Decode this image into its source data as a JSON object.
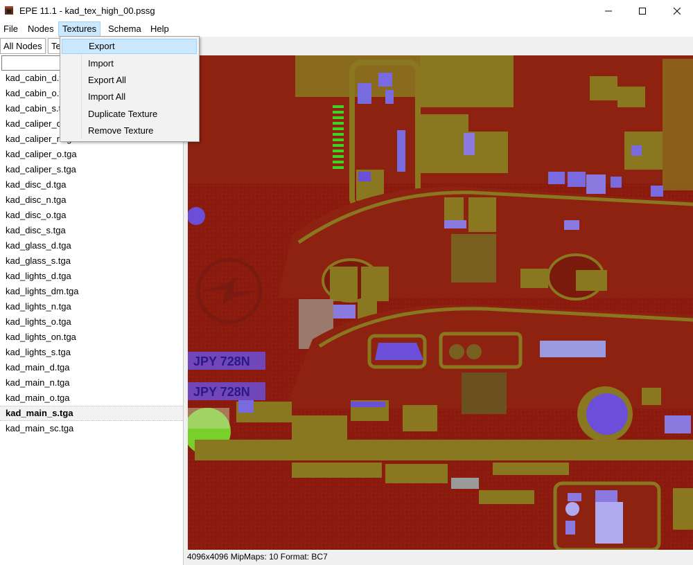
{
  "window": {
    "title": "EPE 11.1 - kad_tex_high_00.pssg",
    "minimize_icon": "minimize-icon",
    "maximize_icon": "maximize-icon",
    "close_icon": "close-icon"
  },
  "menu": {
    "file": "File",
    "nodes": "Nodes",
    "textures": "Textures",
    "schema": "Schema",
    "help": "Help"
  },
  "tabs": {
    "all_nodes": "All Nodes",
    "textures_partial": "Te"
  },
  "dropdown": {
    "items": [
      "Export",
      "Import",
      "Export All",
      "Import All",
      "Duplicate Texture",
      "Remove Texture"
    ]
  },
  "search": {
    "value": ""
  },
  "files": [
    "kad_cabin_d.tga",
    "kad_cabin_o.tga",
    "kad_cabin_s.tga",
    "kad_caliper_d.tga",
    "kad_caliper_n.tga",
    "kad_caliper_o.tga",
    "kad_caliper_s.tga",
    "kad_disc_d.tga",
    "kad_disc_n.tga",
    "kad_disc_o.tga",
    "kad_disc_s.tga",
    "kad_glass_d.tga",
    "kad_glass_s.tga",
    "kad_lights_d.tga",
    "kad_lights_dm.tga",
    "kad_lights_n.tga",
    "kad_lights_o.tga",
    "kad_lights_on.tga",
    "kad_lights_s.tga",
    "kad_main_d.tga",
    "kad_main_n.tga",
    "kad_main_o.tga",
    "kad_main_s.tga",
    "kad_main_sc.tga"
  ],
  "selected_file": "kad_main_s.tga",
  "texture": {
    "plates": [
      "JPY 728N",
      "JPY 728N"
    ],
    "status": "4096x4096 MipMaps: 10 Format: BC7"
  },
  "colors": {
    "base_red": "#8b1a0f",
    "olive": "#8a7a1a",
    "purple": "#6b4fd8",
    "green": "#3fd32a"
  }
}
